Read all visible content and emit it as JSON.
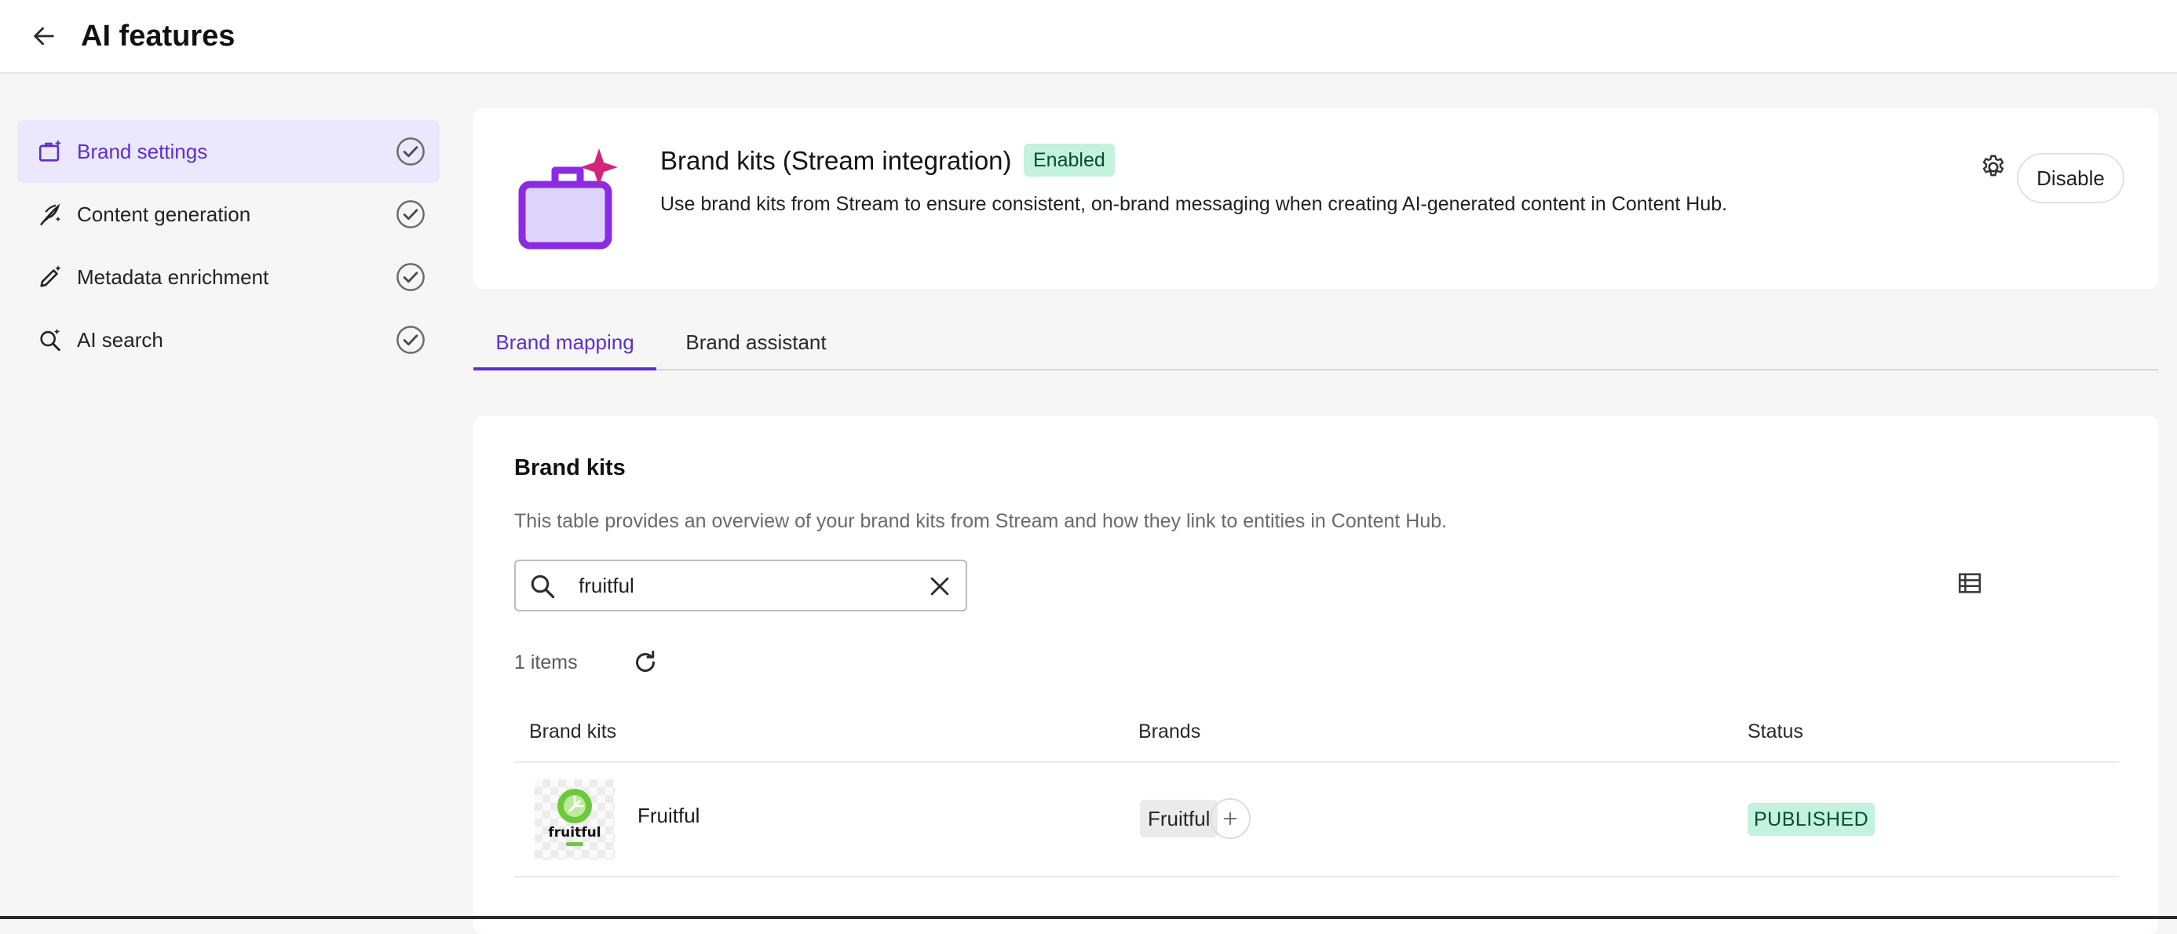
{
  "header": {
    "title": "AI features"
  },
  "sidebar": {
    "items": [
      {
        "label": "Brand settings",
        "active": true
      },
      {
        "label": "Content generation",
        "active": false
      },
      {
        "label": "Metadata enrichment",
        "active": false
      },
      {
        "label": "AI search",
        "active": false
      }
    ]
  },
  "feature": {
    "title": "Brand kits (Stream integration)",
    "badge": "Enabled",
    "description": "Use brand kits from Stream to ensure consistent, on-brand messaging when creating AI-generated content in Content Hub.",
    "disable_label": "Disable"
  },
  "tabs": [
    {
      "label": "Brand mapping",
      "active": true
    },
    {
      "label": "Brand assistant",
      "active": false
    }
  ],
  "brand_kits": {
    "title": "Brand kits",
    "description": "This table provides an overview of your brand kits from Stream and how they link to entities in Content Hub.",
    "search_value": "fruitful",
    "items_count": "1 items",
    "columns": [
      "Brand kits",
      "Brands",
      "Status"
    ],
    "rows": [
      {
        "name": "Fruitful",
        "brand": "Fruitful",
        "status": "PUBLISHED",
        "logo_text": "fruitful"
      }
    ]
  },
  "colors": {
    "accent": "#5b2fd1",
    "badge_bg": "#c3f2df",
    "logo_green": "#6cc83c",
    "logo_pink": "#d6237a"
  }
}
